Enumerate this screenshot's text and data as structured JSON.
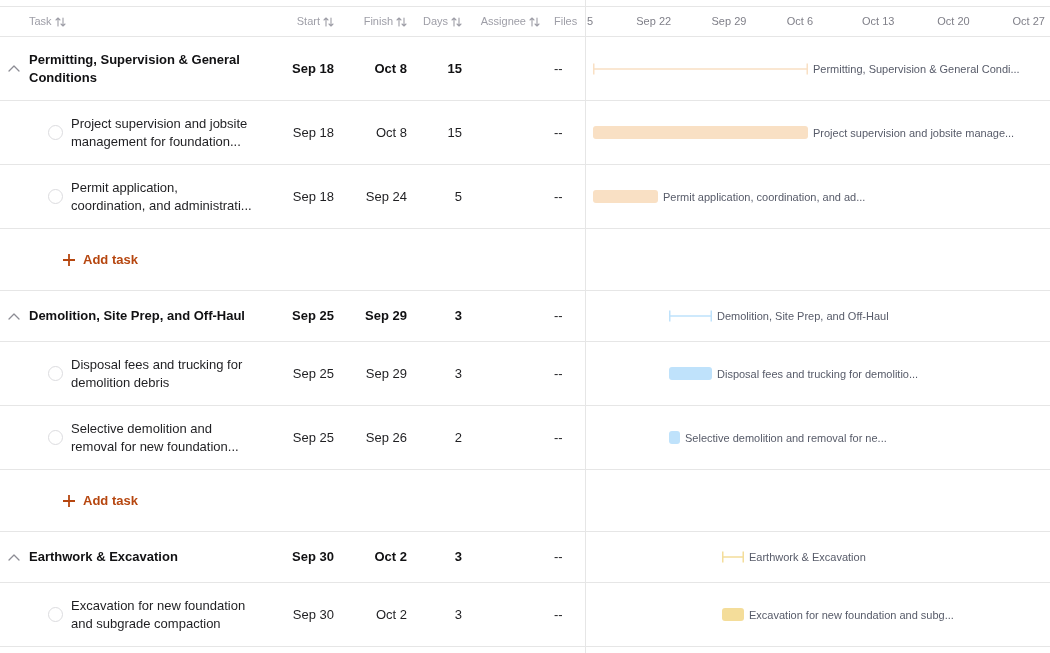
{
  "columns": [
    {
      "label": "Task",
      "sortable": true
    },
    {
      "label": "Start",
      "sortable": true
    },
    {
      "label": "Finish",
      "sortable": true
    },
    {
      "label": "Days",
      "sortable": true
    },
    {
      "label": "Assignee",
      "sortable": true
    },
    {
      "label": "Files",
      "sortable": false
    }
  ],
  "timeline": {
    "date_labels": [
      "5",
      "Sep 22",
      "Sep 29",
      "Oct 6",
      "Oct 13",
      "Oct 20",
      "Oct 27"
    ]
  },
  "groups": [
    {
      "title": "Permitting, Supervision & General Conditions",
      "start": "Sep 18",
      "finish": "Oct 8",
      "days": "15",
      "files": "--",
      "expanded": true,
      "color": "#f9e0c4",
      "bar_label": "Permitting, Supervision & General Condi...",
      "tasks": [
        {
          "name": "Project supervision and jobsite management for foundation...",
          "start": "Sep 18",
          "finish": "Oct 8",
          "days": "15",
          "files": "--",
          "completed": false,
          "bar_label": "Project supervision and jobsite manage..."
        },
        {
          "name": "Permit application, coordination, and administrati...",
          "start": "Sep 18",
          "finish": "Sep 24",
          "days": "5",
          "files": "--",
          "completed": false,
          "bar_label": "Permit application, coordination, and ad..."
        }
      ],
      "add_task": "Add task"
    },
    {
      "title": "Demolition, Site Prep, and Off-Haul",
      "start": "Sep 25",
      "finish": "Sep 29",
      "days": "3",
      "files": "--",
      "expanded": true,
      "color": "#bfe2fb",
      "bar_label": "Demolition, Site Prep, and Off-Haul",
      "tasks": [
        {
          "name": "Disposal fees and trucking for demolition debris",
          "start": "Sep 25",
          "finish": "Sep 29",
          "days": "3",
          "files": "--",
          "completed": false,
          "bar_label": "Disposal fees and trucking for demolitio..."
        },
        {
          "name": "Selective demolition and removal for new foundation...",
          "start": "Sep 25",
          "finish": "Sep 26",
          "days": "2",
          "files": "--",
          "completed": false,
          "bar_label": "Selective demolition and removal for ne..."
        }
      ],
      "add_task": "Add task"
    },
    {
      "title": "Earthwork & Excavation",
      "start": "Sep 30",
      "finish": "Oct 2",
      "days": "3",
      "files": "--",
      "expanded": true,
      "color": "#f4dd9a",
      "bar_label": "Earthwork & Excavation",
      "tasks": [
        {
          "name": "Excavation for new foundation and subgrade compaction",
          "start": "Sep 30",
          "finish": "Oct 2",
          "days": "3",
          "files": "--",
          "completed": false,
          "bar_label": "Excavation for new foundation and subg..."
        }
      ]
    }
  ]
}
